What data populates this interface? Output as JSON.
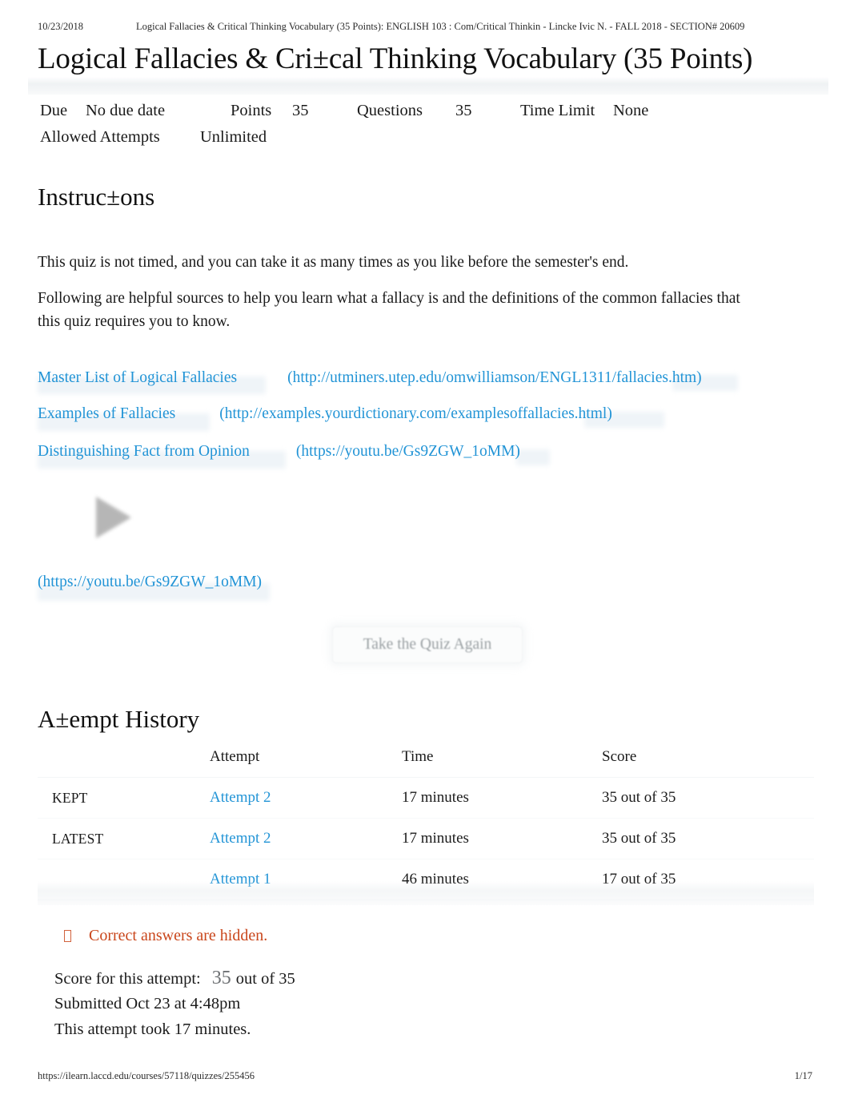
{
  "print_header": {
    "date": "10/23/2018",
    "title": "Logical Fallacies & Critical Thinking Vocabulary (35 Points): ENGLISH 103 : Com/Critical Thinkin - Lincke Ivic N. - FALL 2018 - SECTION# 20609"
  },
  "print_footer": {
    "url": "https://ilearn.laccd.edu/courses/57118/quizzes/255456",
    "page": "1/17"
  },
  "quiz": {
    "title": "Logical Fallacies & Cri±cal Thinking Vocabulary (35 Points)",
    "meta": {
      "due_label": "Due",
      "due_value": "No due date",
      "points_label": "Points",
      "points_value": "35",
      "questions_label": "Questions",
      "questions_value": "35",
      "time_limit_label": "Time Limit",
      "time_limit_value": "None",
      "allowed_attempts_label": "Allowed Attempts",
      "allowed_attempts_value": "Unlimited"
    }
  },
  "instructions": {
    "heading": "Instruc±ons",
    "paragraph_1": "This quiz is not timed, and you can take it as many times as you like before the semester's end.",
    "paragraph_2": "Following are helpful sources to help you learn what a fallacy is and the definitions of the common fallacies that this quiz requires you to know.",
    "links": [
      {
        "label": "Master List of Logical Fallacies",
        "url_text": "(http://utminers.utep.edu/omwilliamson/ENGL1311/fallacies.htm)"
      },
      {
        "label": "Examples of Fallacies",
        "url_text": "(http://examples.yourdictionary.com/examplesoffallacies.html)"
      },
      {
        "label": "Distinguishing Fact from Opinion",
        "url_text": "(https://youtu.be/Gs9ZGW_1oMM)"
      }
    ],
    "video_url_text": "(https://youtu.be/Gs9ZGW_1oMM)"
  },
  "actions": {
    "take_quiz_again": "Take the Quiz Again"
  },
  "attempt_history": {
    "heading": "A±empt History",
    "columns": [
      "",
      "Attempt",
      "Time",
      "Score"
    ],
    "rows": [
      {
        "flag": "KEPT",
        "attempt": "Attempt 2",
        "time": "17 minutes",
        "score": "35 out of 35"
      },
      {
        "flag": "LATEST",
        "attempt": "Attempt 2",
        "time": "17 minutes",
        "score": "35 out of 35"
      },
      {
        "flag": "",
        "attempt": "Attempt 1",
        "time": "46 minutes",
        "score": "17 out of 35"
      }
    ]
  },
  "result": {
    "notice": "Correct answers are hidden.",
    "score_label": "Score for this attempt:",
    "score_value": "35",
    "score_suffix": "out of 35",
    "submitted": "Submitted Oct 23 at 4:48pm",
    "duration": "This attempt took 17 minutes."
  },
  "colors": {
    "link": "#2294d6",
    "notice": "#c9461b",
    "text": "#1a1a1a"
  }
}
